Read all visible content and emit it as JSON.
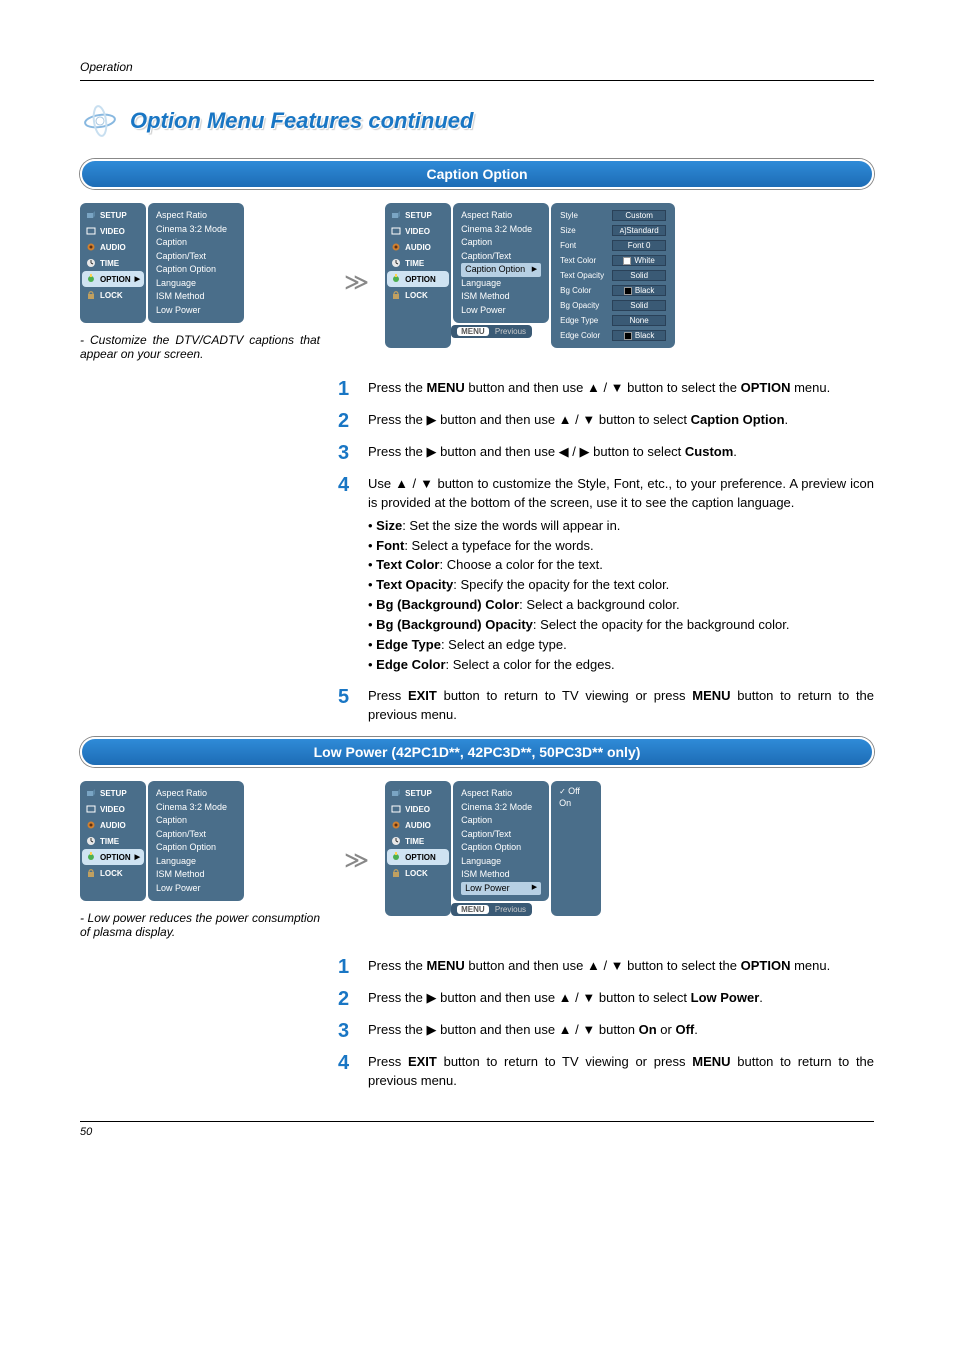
{
  "header": {
    "section": "Operation"
  },
  "page_title": "Option Menu Features continued",
  "caption_option": {
    "band_title": "Caption Option",
    "osd_menu": [
      "SETUP",
      "VIDEO",
      "AUDIO",
      "TIME",
      "OPTION",
      "LOCK"
    ],
    "osd_selected": "OPTION",
    "osd_list": [
      "Aspect Ratio",
      "Cinema 3:2 Mode",
      "Caption",
      "Caption/Text",
      "Caption Option",
      "Language",
      "ISM Method",
      "Low Power"
    ],
    "osd_highlight": "Caption Option",
    "settings": [
      {
        "label": "Style",
        "value": "Custom",
        "swatch": null
      },
      {
        "label": "Size",
        "value": "Standard",
        "swatch": null,
        "prefix": "A]"
      },
      {
        "label": "Font",
        "value": "Font  0",
        "swatch": null
      },
      {
        "label": "Text Color",
        "value": "White",
        "swatch": "#fff"
      },
      {
        "label": "Text Opacity",
        "value": "Solid",
        "swatch": null
      },
      {
        "label": "Bg Color",
        "value": "Black",
        "swatch": "#000"
      },
      {
        "label": "Bg Opacity",
        "value": "Solid",
        "swatch": null
      },
      {
        "label": "Edge Type",
        "value": "None",
        "swatch": null
      },
      {
        "label": "Edge Color",
        "value": "Black",
        "swatch": "#000"
      }
    ],
    "footer_menu": "MENU",
    "footer_prev": "Previous",
    "note": "- Customize the DTV/CADTV captions that appear on your screen.",
    "steps": [
      {
        "n": "1",
        "body_parts": [
          "Press the ",
          {
            "b": "MENU"
          },
          " button and then use ▲ / ▼  button to select the ",
          {
            "b": "OPTION"
          },
          " menu."
        ]
      },
      {
        "n": "2",
        "body_parts": [
          "Press the ▶ button and then use ▲ / ▼ button to select ",
          {
            "b": "Caption Option"
          },
          "."
        ]
      },
      {
        "n": "3",
        "body_parts": [
          "Press the ▶ button and then use ◀ / ▶ button to select ",
          {
            "b": "Custom"
          },
          "."
        ]
      },
      {
        "n": "4",
        "body_parts": [
          "Use ▲ / ▼ button to customize the Style, Font, etc., to your preference. A preview icon is provided at the bottom of the screen, use it to see the caption language."
        ],
        "bullets": [
          {
            "b": "Size",
            "t": ": Set the size the words will appear in."
          },
          {
            "b": "Font",
            "t": ": Select a typeface for the words."
          },
          {
            "b": "Text Color",
            "t": ": Choose a color for the text."
          },
          {
            "b": "Text Opacity",
            "t": ": Specify the opacity for the text color."
          },
          {
            "b": "Bg (Background) Color",
            "t": ": Select a background color."
          },
          {
            "b": "Bg (Background) Opacity",
            "t": ": Select the opacity for the background color."
          },
          {
            "b": "Edge Type",
            "t": ": Select an edge type."
          },
          {
            "b": "Edge Color",
            "t": ": Select a color for the edges."
          }
        ]
      },
      {
        "n": "5",
        "body_parts": [
          "Press ",
          {
            "b": "EXIT"
          },
          " button to return to TV viewing or press ",
          {
            "b": "MENU"
          },
          " button to return to the previous menu."
        ]
      }
    ]
  },
  "low_power": {
    "band_title": "Low Power (42PC1D**, 42PC3D**, 50PC3D** only)",
    "osd_menu": [
      "SETUP",
      "VIDEO",
      "AUDIO",
      "TIME",
      "OPTION",
      "LOCK"
    ],
    "osd_selected": "OPTION",
    "osd_list": [
      "Aspect Ratio",
      "Cinema 3:2 Mode",
      "Caption",
      "Caption/Text",
      "Caption Option",
      "Language",
      "ISM Method",
      "Low Power"
    ],
    "osd_highlight": "Low Power",
    "options": [
      "Off",
      "On"
    ],
    "options_selected": "Off",
    "footer_menu": "MENU",
    "footer_prev": "Previous",
    "note": "- Low power reduces the power consumption of plasma display.",
    "steps": [
      {
        "n": "1",
        "body_parts": [
          "Press the ",
          {
            "b": "MENU"
          },
          " button and then use ▲ / ▼  button to select the ",
          {
            "b": "OPTION"
          },
          " menu."
        ]
      },
      {
        "n": "2",
        "body_parts": [
          "Press the ▶ button and then use ▲ / ▼ button to select ",
          {
            "b": "Low Power"
          },
          "."
        ]
      },
      {
        "n": "3",
        "body_parts": [
          "Press the ▶ button and then use ▲ / ▼ button ",
          {
            "b": "On"
          },
          " or ",
          {
            "b": "Off"
          },
          "."
        ]
      },
      {
        "n": "4",
        "body_parts": [
          "Press ",
          {
            "b": "EXIT"
          },
          " button to return to TV viewing or press ",
          {
            "b": "MENU"
          },
          " button to return to the previous menu."
        ]
      }
    ]
  },
  "page_number": "50"
}
